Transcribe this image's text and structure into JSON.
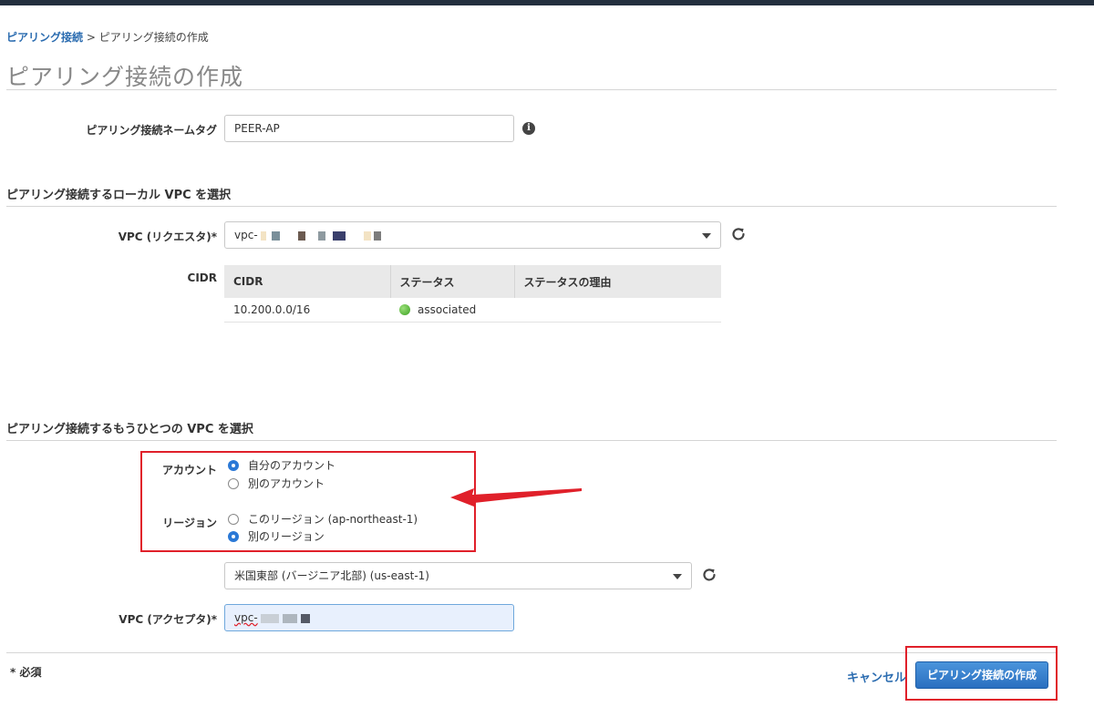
{
  "breadcrumb": {
    "parent": "ピアリング接続",
    "separator": ">",
    "current": "ピアリング接続の作成"
  },
  "page_title": "ピアリング接続の作成",
  "name_tag": {
    "label": "ピアリング接続ネームタグ",
    "value": "PEER-AP",
    "info_icon": "info-icon"
  },
  "local_section": {
    "heading": "ピアリング接続するローカル VPC を選択",
    "vpc_label": "VPC (リクエスタ)*",
    "vpc_value": "vpc-",
    "cidr_label": "CIDR",
    "table": {
      "columns": [
        "CIDR",
        "ステータス",
        "ステータスの理由"
      ],
      "rows": [
        {
          "cidr": "10.200.0.0/16",
          "status": "associated",
          "reason": ""
        }
      ]
    }
  },
  "peer_section": {
    "heading": "ピアリング接続するもうひとつの VPC を選択",
    "account_label": "アカウント",
    "account_options": [
      "自分のアカウント",
      "別のアカウント"
    ],
    "account_selected": 0,
    "region_label": "リージョン",
    "region_options": [
      "このリージョン (ap-northeast-1)",
      "別のリージョン"
    ],
    "region_selected": 1,
    "region_select_value": "米国東部 (バージニア北部) (us-east-1)",
    "vpc_label": "VPC (アクセプタ)*",
    "vpc_value": "vpc-"
  },
  "footer": {
    "required_note": "* 必須",
    "cancel_label": "キャンセル",
    "create_label": "ピアリング接続の作成"
  },
  "colors": {
    "accent": "#2b6cb0",
    "highlight": "#e0202a",
    "topbar": "#232f3e"
  }
}
